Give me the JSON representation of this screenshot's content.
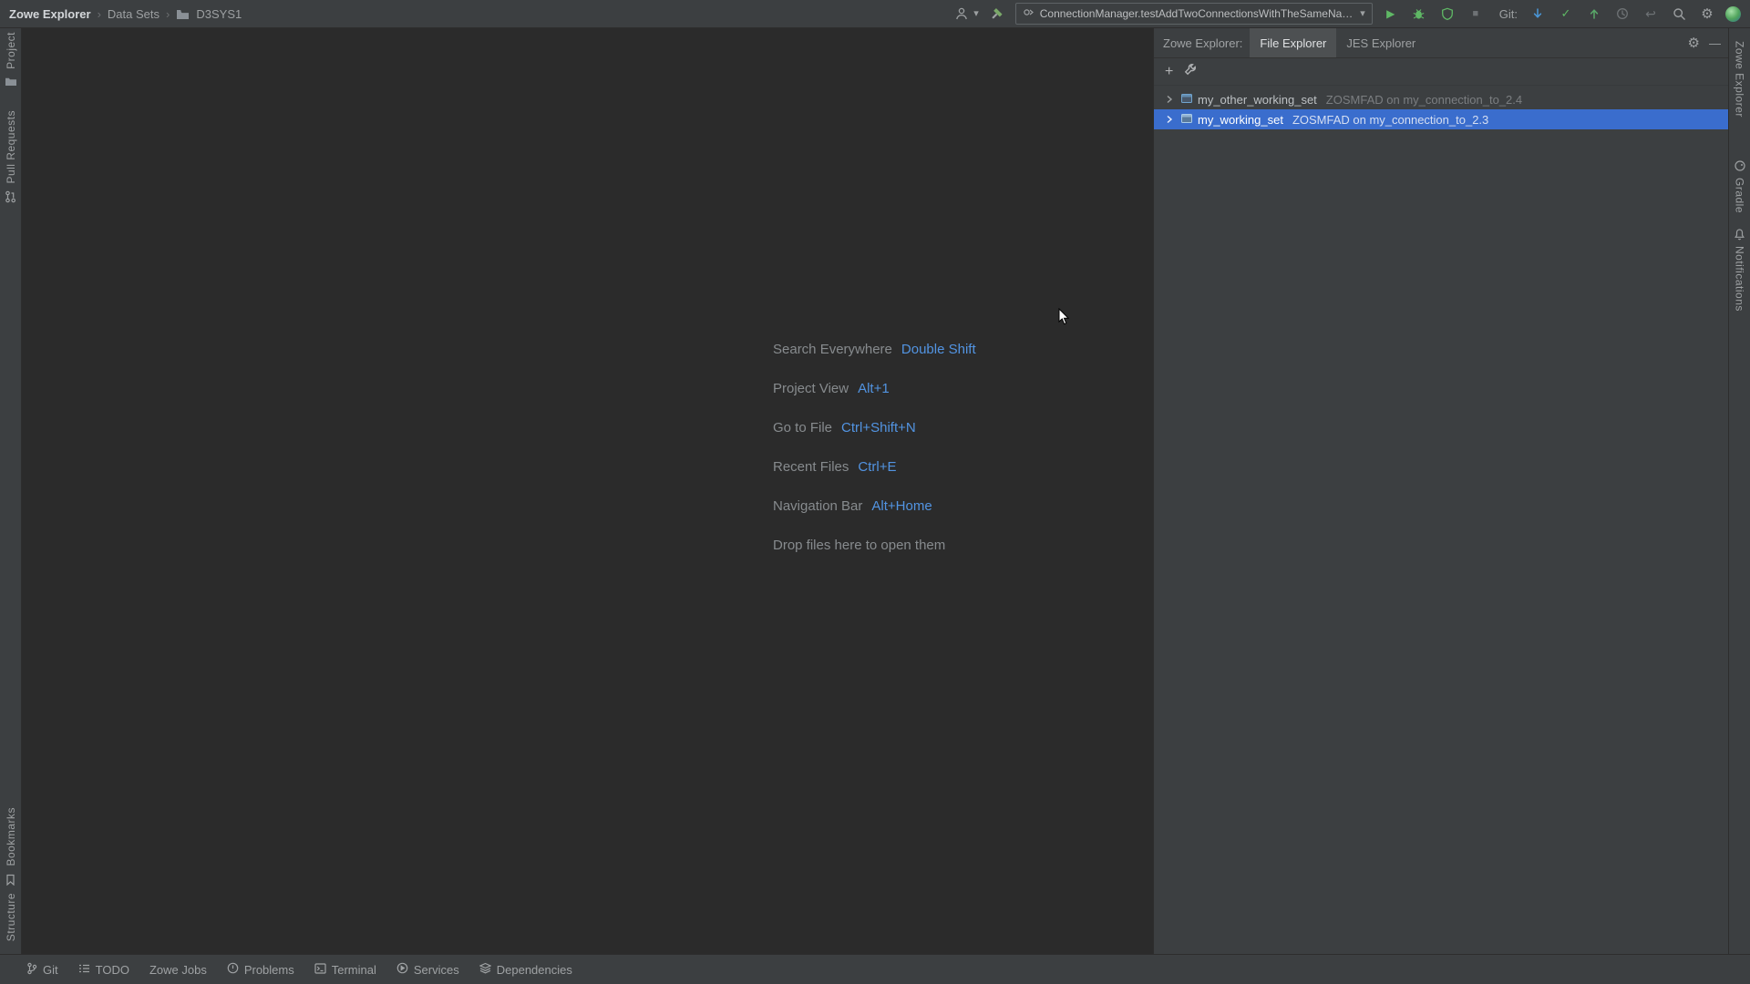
{
  "topbar": {
    "breadcrumb": [
      "Zowe Explorer",
      "Data Sets",
      "D3SYS1"
    ],
    "run_config": "ConnectionManager.testAddTwoConnectionsWithTheSameName",
    "git_label": "Git:"
  },
  "left_stripe": {
    "project": "Project",
    "pull_requests": "Pull Requests",
    "bookmarks": "Bookmarks",
    "structure": "Structure"
  },
  "right_stripe": {
    "zowe_explorer": "Zowe Explorer",
    "gradle": "Gradle",
    "notifications": "Notifications"
  },
  "editor": {
    "hints": [
      {
        "label": "Search Everywhere",
        "shortcut": "Double Shift"
      },
      {
        "label": "Project View",
        "shortcut": "Alt+1"
      },
      {
        "label": "Go to File",
        "shortcut": "Ctrl+Shift+N"
      },
      {
        "label": "Recent Files",
        "shortcut": "Ctrl+E"
      },
      {
        "label": "Navigation Bar",
        "shortcut": "Alt+Home"
      },
      {
        "label": "Drop files here to open them",
        "shortcut": ""
      }
    ]
  },
  "tool_window": {
    "title": "Zowe Explorer:",
    "tabs": [
      {
        "label": "File Explorer"
      },
      {
        "label": "JES Explorer"
      }
    ],
    "tree": [
      {
        "name": "my_other_working_set",
        "detail": "ZOSMFAD on my_connection_to_2.4"
      },
      {
        "name": "my_working_set",
        "detail": "ZOSMFAD on my_connection_to_2.3"
      }
    ]
  },
  "status_bar": [
    "Git",
    "TODO",
    "Zowe Jobs",
    "Problems",
    "Terminal",
    "Services",
    "Dependencies"
  ],
  "glyphs": {
    "chevron": "›",
    "caret_down": "▾",
    "play": "▶",
    "stop": "■",
    "check": "✓",
    "rollback": "↩",
    "gear": "⚙",
    "plus": "+",
    "minimize": "—"
  },
  "colors": {
    "panel": "#3c3f41",
    "editor_bg": "#2b2b2b",
    "border": "#2d2d2d",
    "selection_blue": "#3a6dcd",
    "shortcut_blue": "#5294e2",
    "run_green": "#5fb865",
    "update_blue": "#4a97d8"
  }
}
